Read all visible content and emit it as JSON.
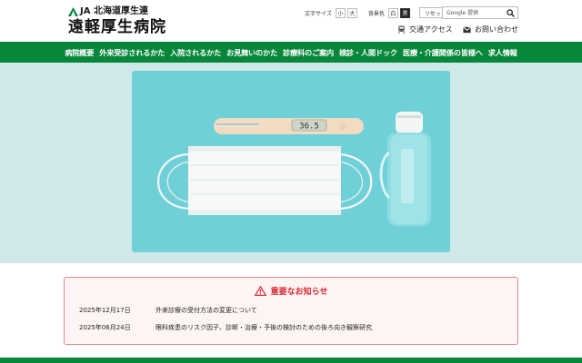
{
  "header": {
    "org_label": "JA 北海道厚生連",
    "hospital_name": "遠軽厚生病院",
    "font_size_label": "文字サイズ",
    "font_small": "小",
    "font_large": "大",
    "bg_color_label": "背景色",
    "bg_white": "白",
    "bg_black": "黒",
    "reset_label": "リセット",
    "search_placeholder": "Google 提供",
    "access_label": "交通アクセス",
    "contact_label": "お問い合わせ"
  },
  "nav": {
    "items": [
      {
        "label": "病院概要"
      },
      {
        "label": "外来受診されるかた"
      },
      {
        "label": "入院されるかた"
      },
      {
        "label": "お見舞いのかた"
      },
      {
        "label": "診療科のご案内"
      },
      {
        "label": "検診・人間ドック"
      },
      {
        "label": "医療・介護関係の皆様へ"
      },
      {
        "label": "求人情報"
      }
    ]
  },
  "hero": {
    "thermometer_reading": "36.5"
  },
  "notice": {
    "heading": "重要なお知らせ",
    "items": [
      {
        "date": "2025年12月17日",
        "title": "外来診療の受付方法の変更について"
      },
      {
        "date": "2025年06月24日",
        "title": "眼科疾患のリスク因子、診断・治療・予後の検討のための後ろ向き観察研究"
      }
    ]
  },
  "colors": {
    "brand_green": "#07873a",
    "hero_bg": "#cfe9ea",
    "image_bg": "#6fd0d7",
    "notice_red": "#d92c35"
  }
}
